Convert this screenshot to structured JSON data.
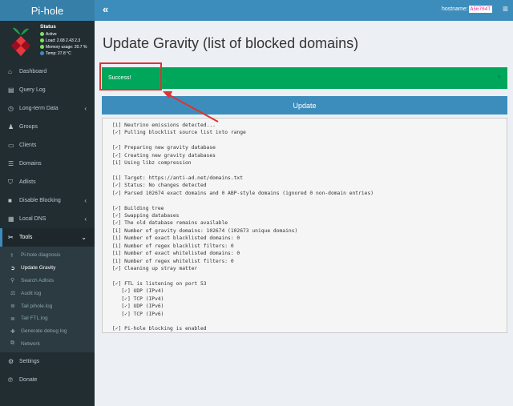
{
  "brand": {
    "name": "Pi-hole"
  },
  "header": {
    "toggle_label": "«",
    "hostname_label": "hostname:",
    "hostname_value": "A56704T",
    "menu_icon": "hamburger-icon"
  },
  "status": {
    "title": "Status",
    "active": "Active",
    "load": "Load:  2.68  2.43  2.3",
    "memory": "Memory usage:  20.7 %",
    "temp": "Temp: 27.8 °C"
  },
  "sidebar": {
    "items": [
      {
        "label": "Dashboard",
        "icon": "home-icon"
      },
      {
        "label": "Query Log",
        "icon": "file-icon"
      },
      {
        "label": "Long-term Data",
        "icon": "history-icon"
      },
      {
        "label": "Groups",
        "icon": "users-icon"
      },
      {
        "label": "Clients",
        "icon": "laptop-icon"
      },
      {
        "label": "Domains",
        "icon": "list-icon"
      },
      {
        "label": "Adlists",
        "icon": "shield-icon"
      },
      {
        "label": "Disable Blocking",
        "icon": "stop-icon"
      },
      {
        "label": "Local DNS",
        "icon": "address-book-icon"
      },
      {
        "label": "Tools",
        "icon": "tools-icon"
      }
    ],
    "tools_sub": [
      {
        "label": "Pi-hole diagnosis",
        "icon": "stethoscope-icon"
      },
      {
        "label": "Update Gravity",
        "icon": "arrow-circle-icon"
      },
      {
        "label": "Search Adlists",
        "icon": "search-icon"
      },
      {
        "label": "Audit log",
        "icon": "balance-icon"
      },
      {
        "label": "Tail pihole.log",
        "icon": "list-ul-icon"
      },
      {
        "label": "Tail FTL.log",
        "icon": "list-ul-icon"
      },
      {
        "label": "Generate debug log",
        "icon": "ambulance-icon"
      },
      {
        "label": "Network",
        "icon": "network-icon"
      }
    ],
    "settings": "Settings",
    "donate": "Donate"
  },
  "page": {
    "title": "Update Gravity (list of blocked domains)",
    "alert": "Success!",
    "alert_close": "×",
    "update_button": "Update",
    "output_lines": [
      "[i] Neutrino emissions detected...",
      "[✓] Pulling blocklist source list into range",
      "",
      "[✓] Preparing new gravity database",
      "[✓] Creating new gravity databases",
      "[i] Using libz compression",
      "",
      "[i] Target: https://anti-ad.net/domains.txt",
      "[✓] Status: No changes detected",
      "[✓] Parsed 102674 exact domains and 0 ABP-style domains (ignored 0 non-domain entries)",
      "",
      "[✓] Building tree",
      "[✓] Swapping databases",
      "[✓] The old database remains available",
      "[i] Number of gravity domains: 102674 (102673 unique domains)",
      "[i] Number of exact blacklisted domains: 0",
      "[i] Number of regex blacklist filters: 0",
      "[i] Number of exact whitelisted domains: 0",
      "[i] Number of regex whitelist filters: 0",
      "[✓] Cleaning up stray matter",
      "",
      "[✓] FTL is listening on port 53",
      "   [✓] UDP (IPv4)",
      "   [✓] TCP (IPv4)",
      "   [✓] UDP (IPv6)",
      "   [✓] TCP (IPv6)",
      "",
      "[✓] Pi-hole blocking is enabled"
    ]
  },
  "colors": {
    "accent": "#3c8dbc",
    "success": "#00a65a",
    "sidebar": "#222d32",
    "annotation": "#dd3333"
  }
}
